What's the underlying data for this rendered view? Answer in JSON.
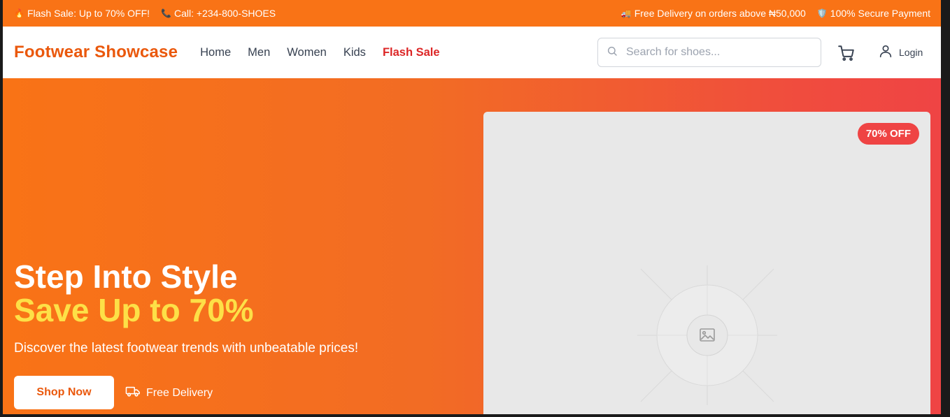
{
  "topbar": {
    "flash_icon": "fire-emoji",
    "flash_text": "Flash Sale: Up to 70% OFF!",
    "call_icon": "phone-emoji",
    "call_text": "Call: +234-800-SHOES",
    "delivery_icon": "truck-emoji",
    "delivery_text": "Free Delivery on orders above ₦50,000",
    "secure_icon": "shield-emoji",
    "secure_text": "100% Secure Payment"
  },
  "header": {
    "logo": "Footwear Showcase",
    "nav": [
      "Home",
      "Men",
      "Women",
      "Kids",
      "Flash Sale"
    ],
    "search_placeholder": "Search for shoes...",
    "login_label": "Login"
  },
  "hero": {
    "title": "Step Into Style",
    "subtitle": "Save Up to 70%",
    "description": "Discover the latest footwear trends with unbeatable prices!",
    "cta_label": "Shop Now",
    "delivery_label": "Free Delivery",
    "badge": "70% OFF"
  },
  "colors": {
    "brand": "#f97316",
    "brand_dark": "#ea580c",
    "flash": "#dc2626",
    "highlight": "#fde047",
    "badge": "#ef4444"
  }
}
